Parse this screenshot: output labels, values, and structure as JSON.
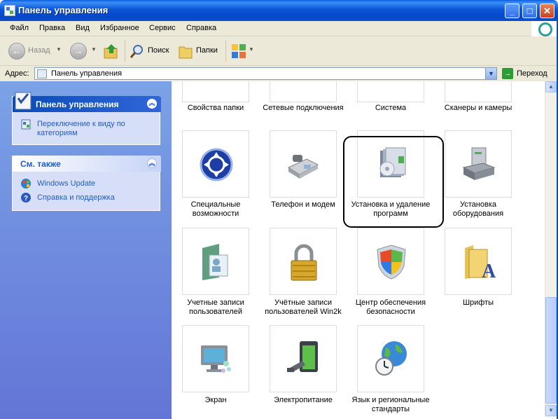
{
  "window": {
    "title": "Панель управления"
  },
  "menu": [
    "Файл",
    "Правка",
    "Вид",
    "Избранное",
    "Сервис",
    "Справка"
  ],
  "toolbar": {
    "back": "Назад",
    "search": "Поиск",
    "folders": "Папки"
  },
  "address": {
    "label": "Адрес:",
    "value": "Панель управления",
    "go": "Переход"
  },
  "left_panels": {
    "tasks": {
      "title": "Панель управления",
      "item": "Переключение к виду по категориям"
    },
    "see_also": {
      "title": "См. также",
      "items": [
        "Windows Update",
        "Справка и поддержка"
      ]
    }
  },
  "items": [
    "Свойства папки",
    "Сетевые подключения",
    "Система",
    "Сканеры и камеры",
    "Специальные возможности",
    "Телефон и модем",
    "Установка и удаление программ",
    "Установка оборудования",
    "Учетные записи пользователей",
    "Учётные записи пользователей Win2k",
    "Центр обеспечения безопасности",
    "Шрифты",
    "Экран",
    "Электропитание",
    "Язык и региональные стандарты"
  ],
  "icons": [
    "folder-options-icon",
    "network-connections-icon",
    "system-icon",
    "scanners-cameras-icon",
    "accessibility-icon",
    "phone-modem-icon",
    "add-remove-programs-icon",
    "add-hardware-icon",
    "user-accounts-icon",
    "padlock-icon",
    "security-center-shield-icon",
    "fonts-folder-icon",
    "display-monitor-icon",
    "power-battery-icon",
    "globe-clock-icon"
  ]
}
